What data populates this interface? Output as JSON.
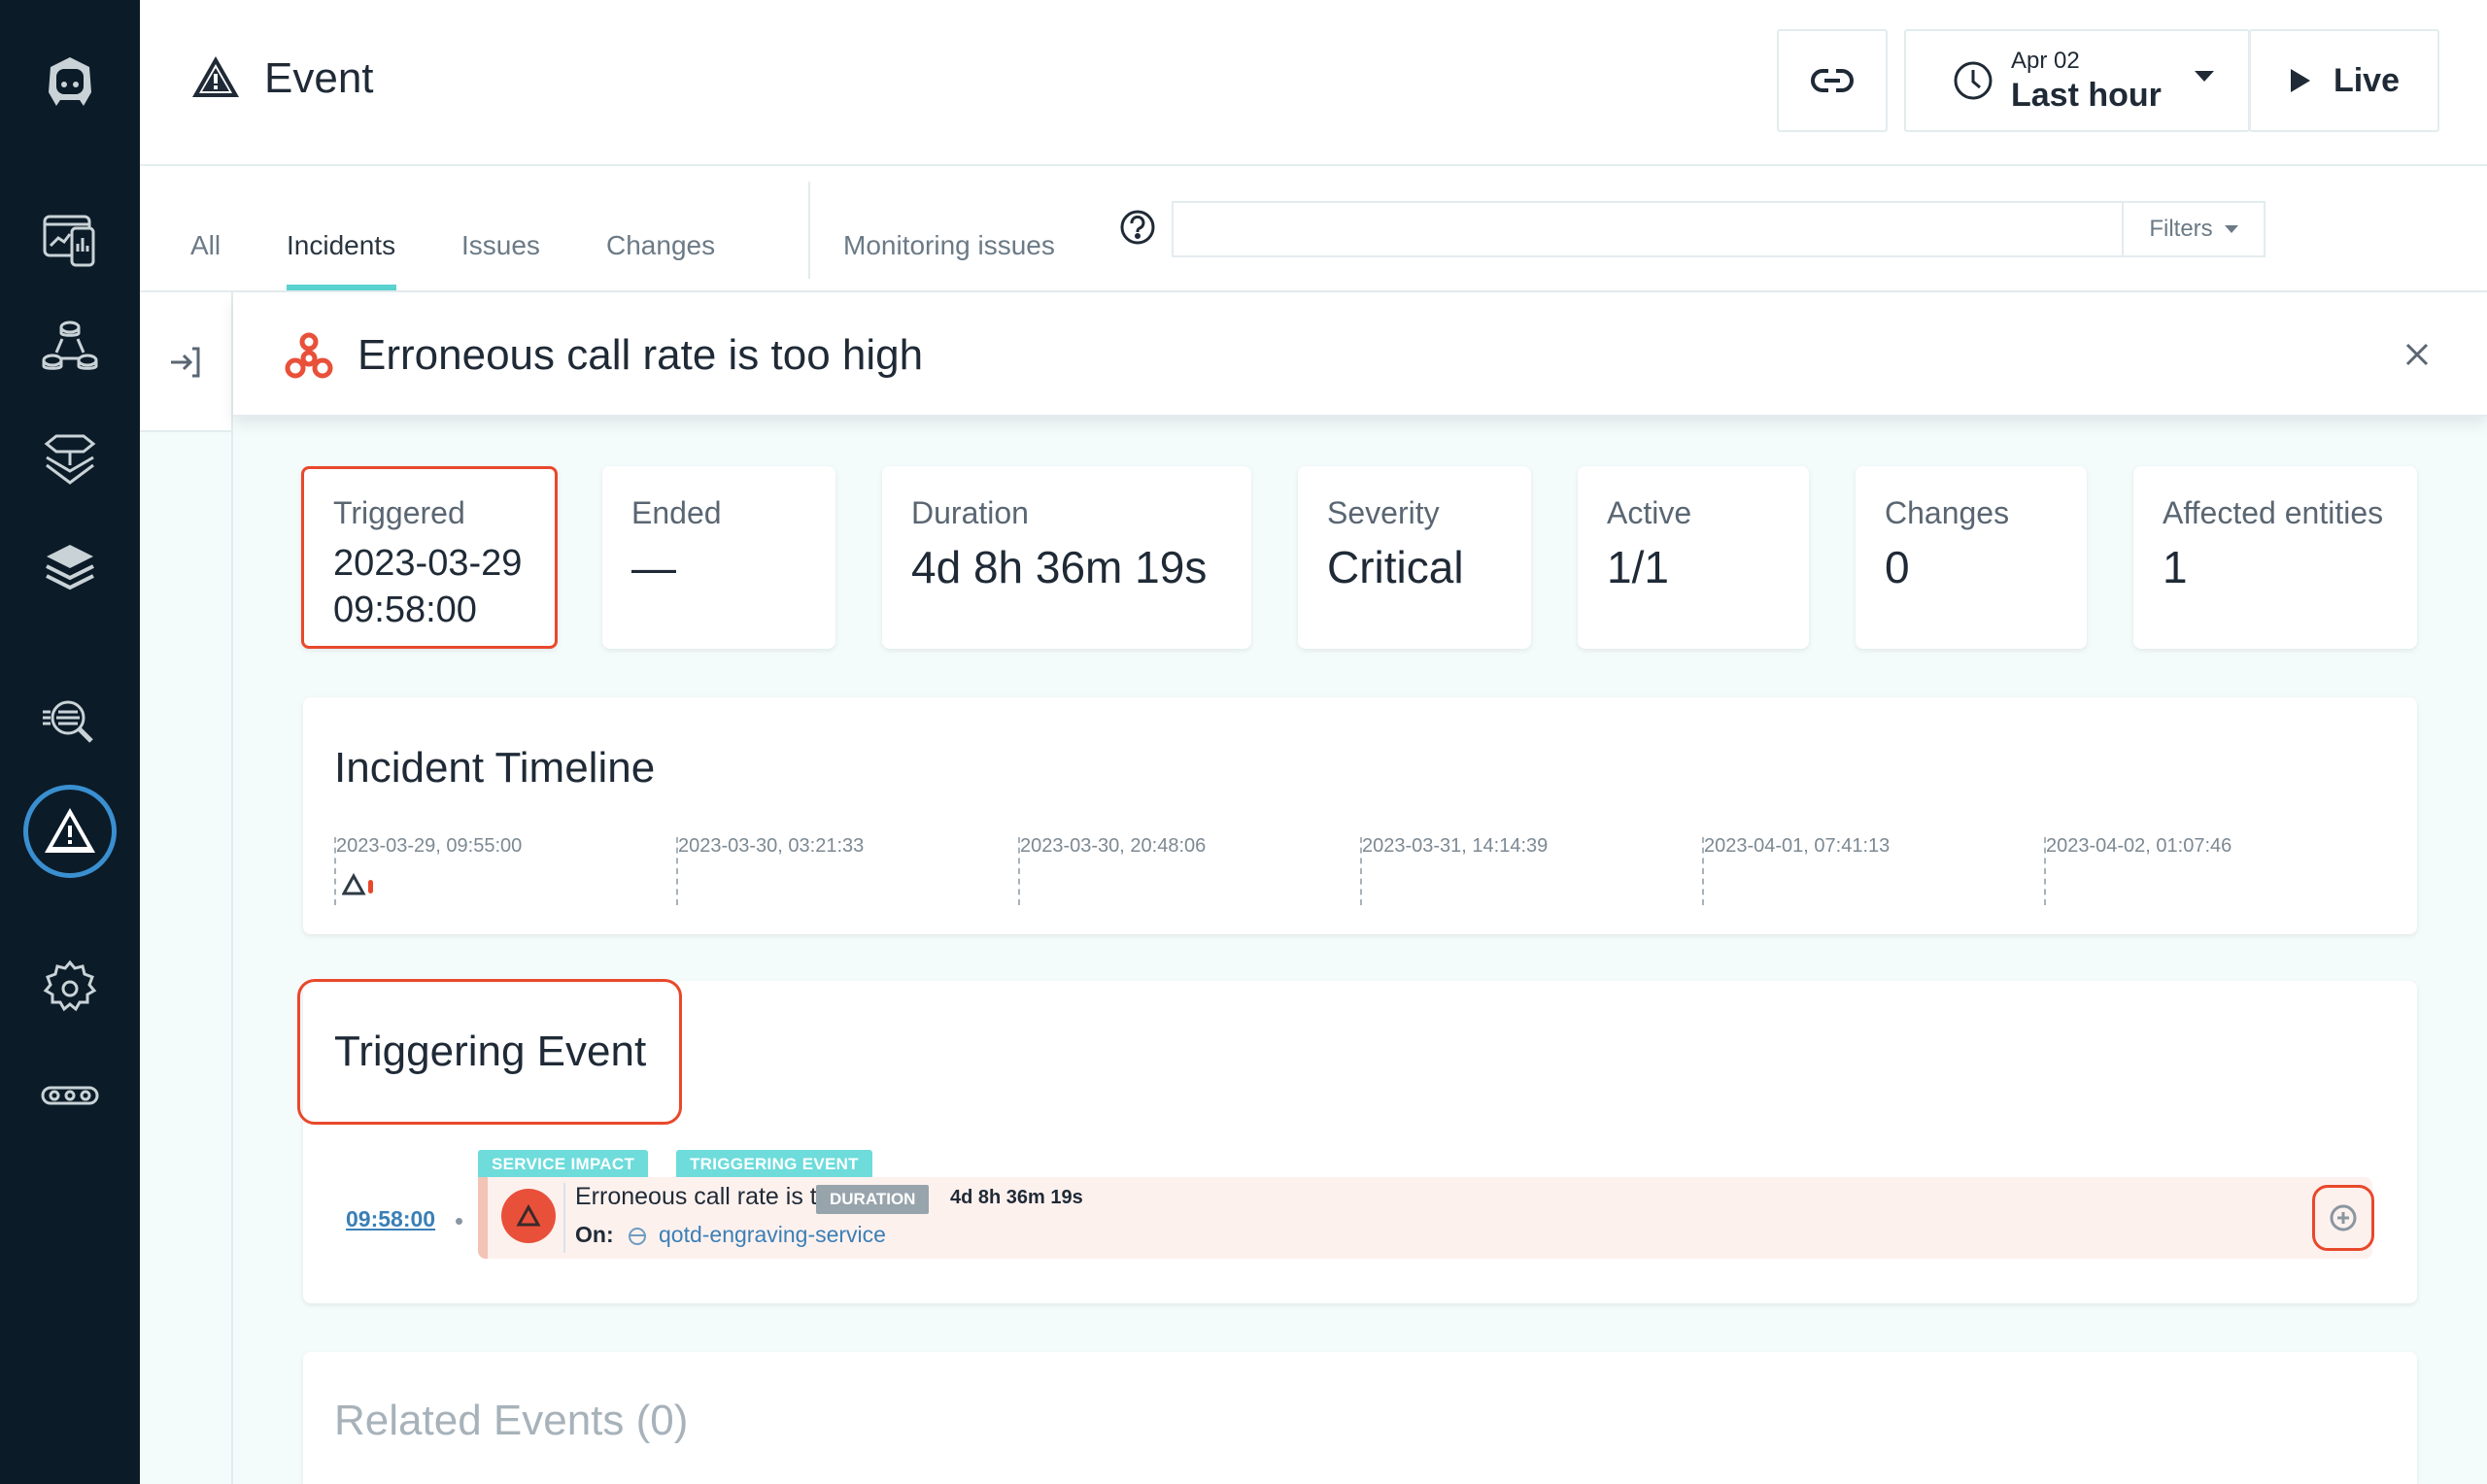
{
  "sidebar": {
    "items": [
      {
        "name": "logo",
        "icon": "robot-logo-icon"
      },
      {
        "name": "websites-mobile-apps",
        "icon": "dashboard-mobile-icon"
      },
      {
        "name": "applications",
        "icon": "app-topology-icon"
      },
      {
        "name": "platforms",
        "icon": "platform-stack-icon"
      },
      {
        "name": "infrastructure",
        "icon": "layers-icon"
      },
      {
        "name": "analytics",
        "icon": "analyze-search-icon"
      },
      {
        "name": "events",
        "icon": "warning-triangle-icon",
        "active": true
      },
      {
        "name": "settings",
        "icon": "gear-icon"
      },
      {
        "name": "more",
        "icon": "more-dots-icon"
      }
    ],
    "active_color": "#3a8fd0"
  },
  "header": {
    "title": "Event",
    "title_icon": "warning-triangle-icon",
    "link_button_icon": "link-icon",
    "time_picker": {
      "date": "Apr 02",
      "range": "Last hour",
      "icon": "clock-icon"
    },
    "live_label": "Live"
  },
  "tabs": {
    "items": [
      {
        "label": "All",
        "active": false
      },
      {
        "label": "Incidents",
        "active": true
      },
      {
        "label": "Issues",
        "active": false
      },
      {
        "label": "Changes",
        "active": false
      },
      {
        "label": "Monitoring issues",
        "active": false
      }
    ],
    "search": {
      "value": "",
      "placeholder": ""
    },
    "filters_label": "Filters",
    "accent": "#5ad2cf"
  },
  "incident": {
    "title": "Erroneous call rate is too high",
    "icon": "incident-cluster-icon",
    "icon_color": "#e9503a",
    "summary": [
      {
        "label": "Triggered",
        "value_line1": "2023-03-29",
        "value_line2": "09:58:00"
      },
      {
        "label": "Ended",
        "value": "—"
      },
      {
        "label": "Duration",
        "value": "4d 8h 36m 19s"
      },
      {
        "label": "Severity",
        "value": "Critical"
      },
      {
        "label": "Active",
        "value": "1/1"
      },
      {
        "label": "Changes",
        "value": "0"
      },
      {
        "label": "Affected entities",
        "value": "1"
      }
    ]
  },
  "timeline": {
    "title": "Incident Timeline",
    "ticks": [
      "2023-03-29, 09:55:00",
      "2023-03-30, 03:21:33",
      "2023-03-30, 20:48:06",
      "2023-03-31, 14:14:39",
      "2023-04-01, 07:41:13",
      "2023-04-02, 01:07:46"
    ]
  },
  "triggering_event": {
    "title": "Triggering Event",
    "time": "09:58:00",
    "tags": [
      "SERVICE IMPACT",
      "TRIGGERING EVENT"
    ],
    "name": "Erroneous call rate is too high",
    "duration_label": "DURATION",
    "duration_value": "4d 8h 36m 19s",
    "on_label": "On:",
    "entity": "qotd-engraving-service",
    "severity_color": "#e9503a"
  },
  "related": {
    "title": "Related Events (0)"
  }
}
